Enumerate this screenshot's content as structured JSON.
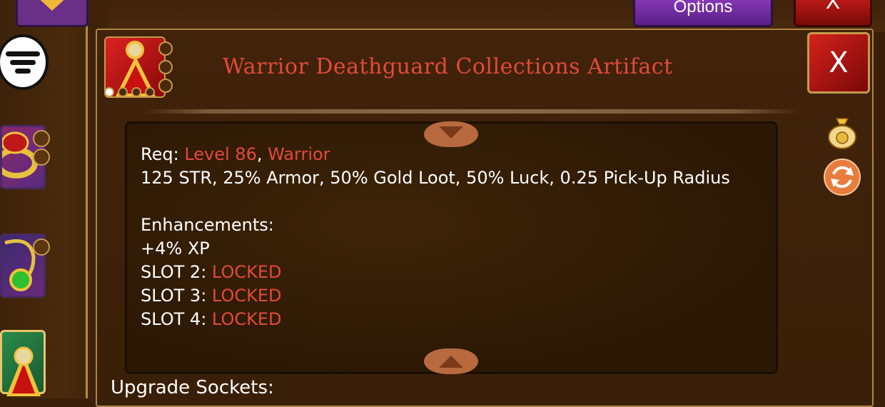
{
  "header": {
    "options_label": "Options",
    "close_label": "X"
  },
  "dialog": {
    "title": "Warrior Deathguard Collections Artifact",
    "close_label": "X",
    "requirements": {
      "prefix": "Req: ",
      "level": "Level 86",
      "separator": ", ",
      "class": "Warrior"
    },
    "stats": "125 STR, 25% Armor, 50% Gold Loot, 50% Luck, 0.25 Pick-Up Radius",
    "enhancements": {
      "heading": "Enhancements:",
      "items": [
        {
          "label": "+4% XP",
          "status": ""
        },
        {
          "label": "SLOT 2: ",
          "status": "LOCKED"
        },
        {
          "label": "SLOT 3: ",
          "status": "LOCKED"
        },
        {
          "label": "SLOT 4: ",
          "status": "LOCKED"
        }
      ]
    },
    "upgrade_sockets_heading": "Upgrade Sockets:"
  },
  "colors": {
    "title": "#e24a3a",
    "locked": "#e24a3a",
    "text": "#ffffff",
    "panel_border": "#b08544"
  },
  "icons": [
    "filter-icon",
    "artifact-icon",
    "gold-bag-icon",
    "swap-icon",
    "scroll-up-icon",
    "scroll-down-icon"
  ]
}
